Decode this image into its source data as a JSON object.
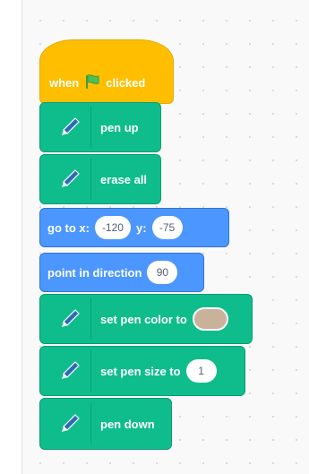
{
  "hat_block": {
    "label_left": "when",
    "flag_icon": "green-flag-icon",
    "label_right": "clicked"
  },
  "blocks": {
    "pen_up": {
      "label": "pen up",
      "icon": "pen-icon"
    },
    "erase_all": {
      "label": "erase all",
      "icon": "pen-icon"
    },
    "go_to": {
      "label_x": "go to x:",
      "x_value": "-120",
      "label_y": "y:",
      "y_value": "-75"
    },
    "point_direction": {
      "label": "point in direction",
      "value": "90"
    },
    "set_pen_color": {
      "label": "set pen color to",
      "color": "#c8b29a",
      "icon": "pen-icon"
    },
    "set_pen_size": {
      "label": "set pen size to",
      "value": "1",
      "icon": "pen-icon"
    },
    "pen_down": {
      "label": "pen down",
      "icon": "pen-icon"
    }
  },
  "colors": {
    "events": "#ffbf00",
    "pen": "#0fbd8c",
    "motion": "#4c97ff",
    "flag": "#4cbf56"
  }
}
